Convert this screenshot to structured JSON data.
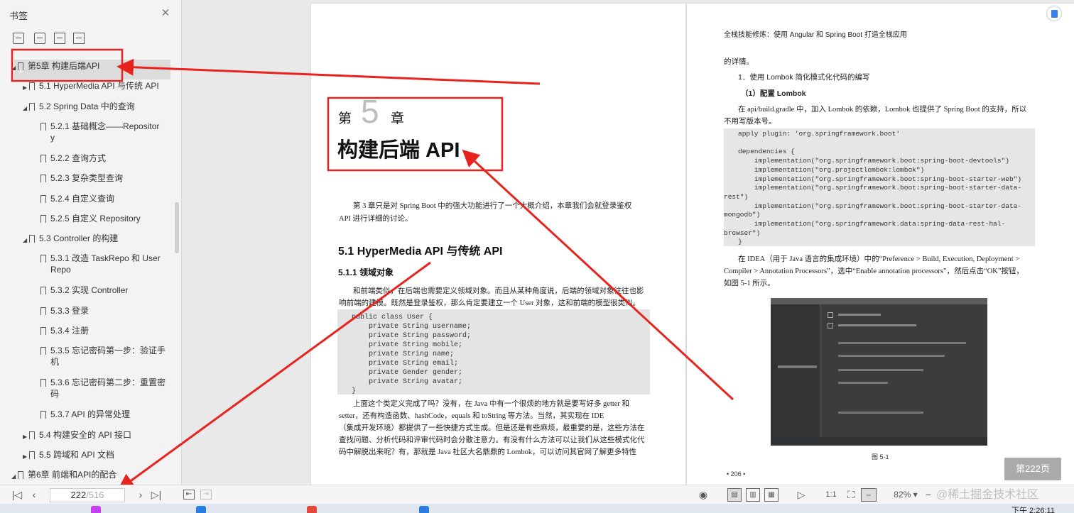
{
  "sidebar": {
    "title": "书签",
    "items": [
      {
        "label": "第5章 构建后端API",
        "label2": "",
        "level": 0,
        "caret": "down"
      },
      {
        "label": "5.1 HyperMedia API 与传统 API",
        "label2": "",
        "level": 1,
        "caret": "right"
      },
      {
        "label": "5.2 Spring Data 中的查询",
        "label2": "",
        "level": 1,
        "caret": "down"
      },
      {
        "label": "5.2.1 基础概念——Repositor",
        "label2": "y",
        "level": 2,
        "caret": ""
      },
      {
        "label": "5.2.2 查询方式",
        "label2": "",
        "level": 2,
        "caret": ""
      },
      {
        "label": "5.2.3 复杂类型查询",
        "label2": "",
        "level": 2,
        "caret": ""
      },
      {
        "label": "5.2.4 自定义查询",
        "label2": "",
        "level": 2,
        "caret": ""
      },
      {
        "label": "5.2.5 自定义 Repository",
        "label2": "",
        "level": 2,
        "caret": ""
      },
      {
        "label": "5.3 Controller 的构建",
        "label2": "",
        "level": 1,
        "caret": "down"
      },
      {
        "label": "5.3.1 改造 TaskRepo 和 User",
        "label2": "Repo",
        "level": 2,
        "caret": ""
      },
      {
        "label": "5.3.2 实现 Controller",
        "label2": "",
        "level": 2,
        "caret": ""
      },
      {
        "label": "5.3.3 登录",
        "label2": "",
        "level": 2,
        "caret": ""
      },
      {
        "label": "5.3.4 注册",
        "label2": "",
        "level": 2,
        "caret": ""
      },
      {
        "label": "5.3.5 忘记密码第一步：验证手",
        "label2": "机",
        "level": 2,
        "caret": ""
      },
      {
        "label": "5.3.6 忘记密码第二步：重置密",
        "label2": "码",
        "level": 2,
        "caret": ""
      },
      {
        "label": "5.3.7 API 的异常处理",
        "label2": "",
        "level": 2,
        "caret": ""
      },
      {
        "label": "5.4 构建安全的 API 接口",
        "label2": "",
        "level": 1,
        "caret": "right"
      },
      {
        "label": "5.5 跨域和 API 文档",
        "label2": "",
        "level": 1,
        "caret": "right"
      },
      {
        "label": "第6章 前端和API的配合",
        "label2": "",
        "level": 0,
        "caret": "down"
      }
    ]
  },
  "left_page": {
    "chapter_prefix": "第",
    "chapter_num": "5",
    "chapter_suffix": "章",
    "chapter_title": "构建后端 API",
    "intro_line1": "第 3 章只是对 Spring Boot 中的强大功能进行了一个大概介绍，本章我们会就登录鉴权",
    "intro_line2": "API 进行详细的讨论。",
    "h2": "5.1  HyperMedia API 与传统 API",
    "h3": "5.1.1  领域对象",
    "p1_line1": "和前端类似，在后端也需要定义领域对象。而且从某种角度说，后端的领域对象往往也影",
    "p1_line2": "响前端的建模。既然是登录鉴权，那么肯定要建立一个 User 对象，这和前端的模型很类似。",
    "code": [
      "public class User {",
      "    private String username;",
      "    private String password;",
      "    private String mobile;",
      "    private String name;",
      "    private String email;",
      "    private Gender gender;",
      "    private String avatar;",
      "}"
    ],
    "p2_lines": [
      "上面这个类定义完成了吗？没有，在 Java 中有一个很烦的地方就是要写好多 getter 和",
      "setter，还有构造函数、hashCode，equals 和 toString 等方法。当然，其实现在 IDE",
      "（集成开发环境）都提供了一些快捷方式生成。但是还是有些麻烦，最重要的是，这些方法在",
      "查找问题、分析代码和评审代码时会分散注意力。有没有什么方法可以让我们从这些模式化代",
      "码中解脱出来呢？有，那就是 Java 社区大名鼎鼎的 Lombok，可以访问其官网了解更多特性"
    ]
  },
  "right_page": {
    "header": "全栈技能修炼：使用 Angular 和 Spring Boot 打造全栈应用",
    "line0": "的详情。",
    "h1": "1．使用 Lombok 简化模式化代码的编写",
    "h2": "（1）配置 Lombok",
    "p1_line1": "在 api/build.gradle 中，加入 Lombok 的依赖，Lombok 也提供了 Spring Boot 的支持，所以",
    "p1_line2": "不用写版本号。",
    "code": [
      "apply plugin: 'org.springframework.boot'",
      "",
      "dependencies {",
      "    implementation(\"org.springframework.boot:spring-boot-devtools\")",
      "    implementation(\"org.projectlombok:lombok\")",
      "    implementation(\"org.springframework.boot:spring-boot-starter-web\")",
      "    implementation(\"org.springframework.boot:spring-boot-starter-data-",
      "rest\")",
      "    implementation(\"org.springframework.boot:spring-boot-starter-data-",
      "mongodb\")",
      "    implementation(\"org.springframework.data:spring-data-rest-hal-",
      "browser\")",
      "}"
    ],
    "p2_line1": "在 IDEA（用于 Java 语言的集成环境）中的“Preference > Build, Execution, Deployment >",
    "p2_line2": "Compiler > Annotation Processors”，选中“Enable annotation processors”，然后点击“OK”按钮，",
    "p2_line3": "如图 5-1 所示。",
    "figure_caption": "图 5-1",
    "page_number": "• 206 •"
  },
  "page_badge": "第222页",
  "bottombar": {
    "current_page": "222",
    "total_pages": "/516",
    "zoom": "82%"
  },
  "watermark": "@稀土掘金技术社区",
  "clock": "下午 2:26:11",
  "colors": {
    "annotation": "#e8231e",
    "sidebar_bg": "#f3f3f3",
    "selection": "#dcdcdc"
  }
}
